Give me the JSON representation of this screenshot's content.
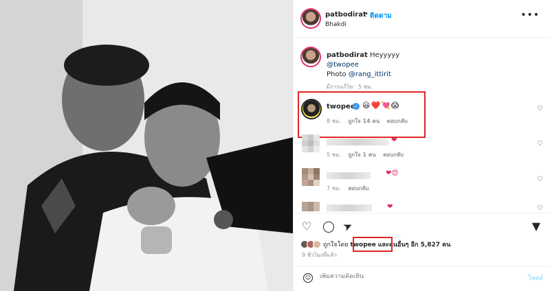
{
  "header": {
    "username": "patbodirat",
    "separator": "•",
    "follow_label": "ติดตาม",
    "location": "Bhakdi",
    "more_icon": "•••"
  },
  "caption": {
    "username": "patbodirat",
    "text": "Heyyyyy",
    "mention": "@twopee",
    "photo_label": "Photo",
    "photo_credit": "@rang_ittirit",
    "edited": "มีการแก้ไข · 5 ชม."
  },
  "comments": [
    {
      "username": "twopee",
      "verified_icon": "✓",
      "emojis": "😃❤️💘😱",
      "time": "8 ชม.",
      "likes": "ถูกใจ 14 คน",
      "reply": "ตอบกลับ"
    },
    {
      "time": "5 ชม.",
      "likes": "ถูกใจ 1 คน",
      "reply": "ตอบกลับ",
      "emoji": "❤"
    },
    {
      "time": "7 ชม.",
      "reply": "ตอบกลับ",
      "emoji": "❤😍"
    },
    {
      "emoji": "❤"
    }
  ],
  "actions": {
    "like_icon": "♡",
    "comment_icon": "◯",
    "share_icon": "➤",
    "save_icon": "▼"
  },
  "likes": {
    "prefix": "ถูกใจโดย",
    "user": "twopee",
    "suffix": "และคนอื่นๆ อีก 5,827 คน"
  },
  "time_ago": "9 ชั่วโมงที่แล้ว",
  "comment_box": {
    "emoji_icon": "☺",
    "placeholder": "เพิ่มความคิดเห็น",
    "post_label": "โพสต์"
  },
  "colors": {
    "accent": "#0095f6",
    "highlight": "#e02424",
    "heart": "#e0245e"
  }
}
